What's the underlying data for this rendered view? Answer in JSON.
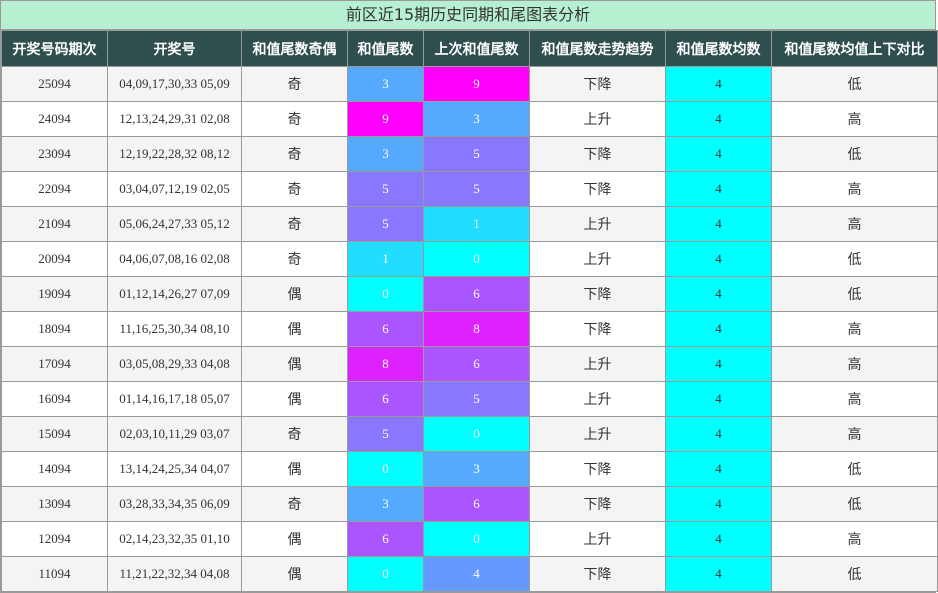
{
  "title": "前区近15期历史同期和尾图表分析",
  "headers": [
    "开奖号码期次",
    "开奖号",
    "和值尾数奇偶",
    "和值尾数",
    "上次和值尾数",
    "和值尾数走势趋势",
    "和值尾数均数",
    "和值尾数均值上下对比"
  ],
  "digit_colors": {
    "0": "#00ffff",
    "1": "#22ddff",
    "3": "#55aaff",
    "4": "#6699ff",
    "5": "#8877ff",
    "6": "#aa55ff",
    "8": "#dd22ff",
    "9": "#ff00ff"
  },
  "avg_color": "#00ffff",
  "header_bg": "#2f4f4f",
  "title_bg": "#b7f0d0",
  "rows": [
    {
      "issue": "25094",
      "numbers": "04,09,17,30,33 05,09",
      "parity": "奇",
      "tail": "3",
      "prev_tail": "9",
      "trend": "下降",
      "avg": "4",
      "compare": "低"
    },
    {
      "issue": "24094",
      "numbers": "12,13,24,29,31 02,08",
      "parity": "奇",
      "tail": "9",
      "prev_tail": "3",
      "trend": "上升",
      "avg": "4",
      "compare": "高"
    },
    {
      "issue": "23094",
      "numbers": "12,19,22,28,32 08,12",
      "parity": "奇",
      "tail": "3",
      "prev_tail": "5",
      "trend": "下降",
      "avg": "4",
      "compare": "低"
    },
    {
      "issue": "22094",
      "numbers": "03,04,07,12,19 02,05",
      "parity": "奇",
      "tail": "5",
      "prev_tail": "5",
      "trend": "下降",
      "avg": "4",
      "compare": "高"
    },
    {
      "issue": "21094",
      "numbers": "05,06,24,27,33 05,12",
      "parity": "奇",
      "tail": "5",
      "prev_tail": "1",
      "trend": "上升",
      "avg": "4",
      "compare": "高"
    },
    {
      "issue": "20094",
      "numbers": "04,06,07,08,16 02,08",
      "parity": "奇",
      "tail": "1",
      "prev_tail": "0",
      "trend": "上升",
      "avg": "4",
      "compare": "低"
    },
    {
      "issue": "19094",
      "numbers": "01,12,14,26,27 07,09",
      "parity": "偶",
      "tail": "0",
      "prev_tail": "6",
      "trend": "下降",
      "avg": "4",
      "compare": "低"
    },
    {
      "issue": "18094",
      "numbers": "11,16,25,30,34 08,10",
      "parity": "偶",
      "tail": "6",
      "prev_tail": "8",
      "trend": "下降",
      "avg": "4",
      "compare": "高"
    },
    {
      "issue": "17094",
      "numbers": "03,05,08,29,33 04,08",
      "parity": "偶",
      "tail": "8",
      "prev_tail": "6",
      "trend": "上升",
      "avg": "4",
      "compare": "高"
    },
    {
      "issue": "16094",
      "numbers": "01,14,16,17,18 05,07",
      "parity": "偶",
      "tail": "6",
      "prev_tail": "5",
      "trend": "上升",
      "avg": "4",
      "compare": "高"
    },
    {
      "issue": "15094",
      "numbers": "02,03,10,11,29 03,07",
      "parity": "奇",
      "tail": "5",
      "prev_tail": "0",
      "trend": "上升",
      "avg": "4",
      "compare": "高"
    },
    {
      "issue": "14094",
      "numbers": "13,14,24,25,34 04,07",
      "parity": "偶",
      "tail": "0",
      "prev_tail": "3",
      "trend": "下降",
      "avg": "4",
      "compare": "低"
    },
    {
      "issue": "13094",
      "numbers": "03,28,33,34,35 06,09",
      "parity": "奇",
      "tail": "3",
      "prev_tail": "6",
      "trend": "下降",
      "avg": "4",
      "compare": "低"
    },
    {
      "issue": "12094",
      "numbers": "02,14,23,32,35 01,10",
      "parity": "偶",
      "tail": "6",
      "prev_tail": "0",
      "trend": "上升",
      "avg": "4",
      "compare": "高"
    },
    {
      "issue": "11094",
      "numbers": "11,21,22,32,34 04,08",
      "parity": "偶",
      "tail": "0",
      "prev_tail": "4",
      "trend": "下降",
      "avg": "4",
      "compare": "低"
    }
  ]
}
